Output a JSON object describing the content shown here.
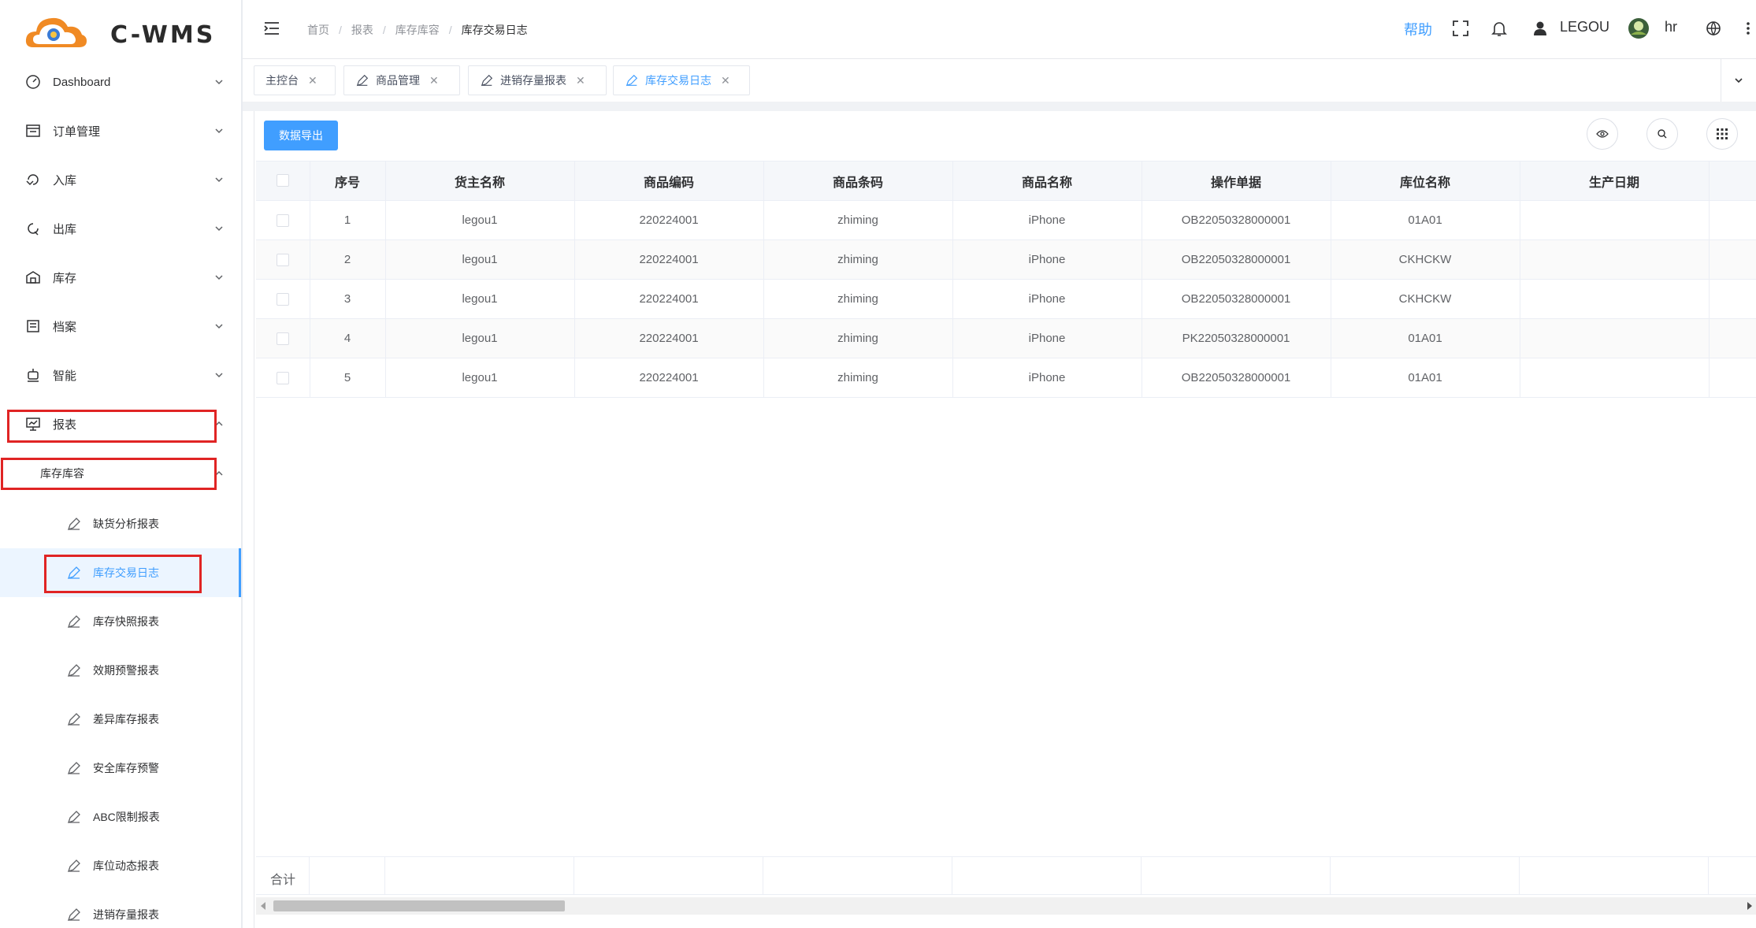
{
  "app": {
    "logo_text": "C-WMS"
  },
  "sidebar": {
    "items": [
      {
        "label": "Dashboard",
        "icon": "dashboard-icon"
      },
      {
        "label": "订单管理",
        "icon": "order-icon"
      },
      {
        "label": "入库",
        "icon": "inbound-icon"
      },
      {
        "label": "出库",
        "icon": "outbound-icon"
      },
      {
        "label": "库存",
        "icon": "warehouse-icon"
      },
      {
        "label": "档案",
        "icon": "archive-icon"
      },
      {
        "label": "智能",
        "icon": "robot-icon"
      },
      {
        "label": "报表",
        "icon": "report-icon"
      }
    ],
    "group_title": "库存库容",
    "sub_items": [
      {
        "label": "缺货分析报表"
      },
      {
        "label": "库存交易日志"
      },
      {
        "label": "库存快照报表"
      },
      {
        "label": "效期预警报表"
      },
      {
        "label": "差异库存报表"
      },
      {
        "label": "安全库存预警"
      },
      {
        "label": "ABC限制报表"
      },
      {
        "label": "库位动态报表"
      },
      {
        "label": "进销存量报表"
      }
    ],
    "active_sub": "库存交易日志"
  },
  "header": {
    "breadcrumb": [
      "首页",
      "报表",
      "库存库容",
      "库存交易日志"
    ],
    "help": "帮助",
    "user": "LEGOU",
    "account": "hr"
  },
  "tabs": [
    {
      "label": "主控台",
      "icon": ""
    },
    {
      "label": "商品管理",
      "icon": "edit-icon"
    },
    {
      "label": "进销存量报表",
      "icon": "edit-icon"
    },
    {
      "label": "库存交易日志",
      "icon": "edit-icon",
      "active": true
    }
  ],
  "toolbar": {
    "export_label": "数据导出"
  },
  "table": {
    "columns": [
      "序号",
      "货主名称",
      "商品编码",
      "商品条码",
      "商品名称",
      "操作单据",
      "库位名称",
      "生产日期"
    ],
    "rows": [
      [
        "1",
        "legou1",
        "220224001",
        "zhiming",
        "iPhone",
        "OB22050328000001",
        "01A01",
        ""
      ],
      [
        "2",
        "legou1",
        "220224001",
        "zhiming",
        "iPhone",
        "OB22050328000001",
        "CKHCKW",
        ""
      ],
      [
        "3",
        "legou1",
        "220224001",
        "zhiming",
        "iPhone",
        "OB22050328000001",
        "CKHCKW",
        ""
      ],
      [
        "4",
        "legou1",
        "220224001",
        "zhiming",
        "iPhone",
        "PK22050328000001",
        "01A01",
        ""
      ],
      [
        "5",
        "legou1",
        "220224001",
        "zhiming",
        "iPhone",
        "OB22050328000001",
        "01A01",
        ""
      ]
    ],
    "footer_label": "合计"
  },
  "colors": {
    "accent": "#409eff",
    "highlight_box": "#e02424"
  }
}
